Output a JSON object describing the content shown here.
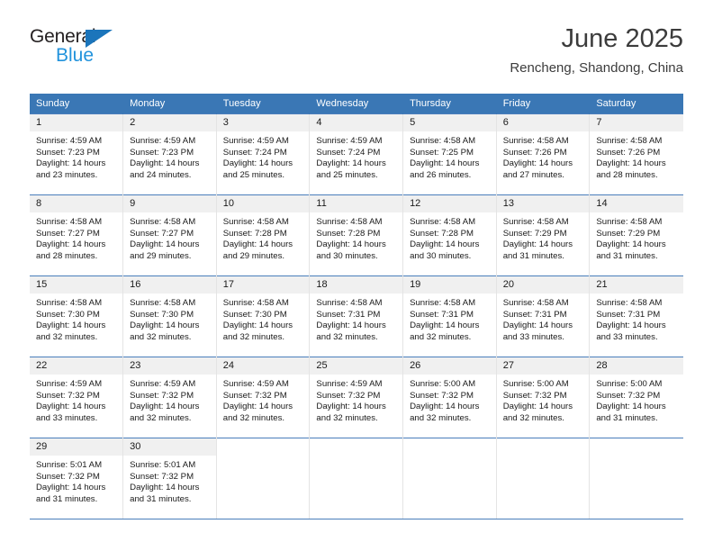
{
  "brand": {
    "name_part1": "General",
    "name_part2": "Blue",
    "triangle_color": "#1b75bb",
    "blue_color": "#2293dc"
  },
  "header": {
    "title": "June 2025",
    "subtitle": "Rencheng, Shandong, China"
  },
  "theme": {
    "header_bg": "#3a77b5",
    "header_text": "#ffffff",
    "row_border": "#4a7ebb",
    "daynum_bg": "#f0f0f0",
    "cell_bg": "#ffffff",
    "text": "#1a1a1a"
  },
  "weekdays": [
    "Sunday",
    "Monday",
    "Tuesday",
    "Wednesday",
    "Thursday",
    "Friday",
    "Saturday"
  ],
  "weeks": [
    [
      {
        "day": "1",
        "sunrise": "Sunrise: 4:59 AM",
        "sunset": "Sunset: 7:23 PM",
        "daylight": "Daylight: 14 hours and 23 minutes."
      },
      {
        "day": "2",
        "sunrise": "Sunrise: 4:59 AM",
        "sunset": "Sunset: 7:23 PM",
        "daylight": "Daylight: 14 hours and 24 minutes."
      },
      {
        "day": "3",
        "sunrise": "Sunrise: 4:59 AM",
        "sunset": "Sunset: 7:24 PM",
        "daylight": "Daylight: 14 hours and 25 minutes."
      },
      {
        "day": "4",
        "sunrise": "Sunrise: 4:59 AM",
        "sunset": "Sunset: 7:24 PM",
        "daylight": "Daylight: 14 hours and 25 minutes."
      },
      {
        "day": "5",
        "sunrise": "Sunrise: 4:58 AM",
        "sunset": "Sunset: 7:25 PM",
        "daylight": "Daylight: 14 hours and 26 minutes."
      },
      {
        "day": "6",
        "sunrise": "Sunrise: 4:58 AM",
        "sunset": "Sunset: 7:26 PM",
        "daylight": "Daylight: 14 hours and 27 minutes."
      },
      {
        "day": "7",
        "sunrise": "Sunrise: 4:58 AM",
        "sunset": "Sunset: 7:26 PM",
        "daylight": "Daylight: 14 hours and 28 minutes."
      }
    ],
    [
      {
        "day": "8",
        "sunrise": "Sunrise: 4:58 AM",
        "sunset": "Sunset: 7:27 PM",
        "daylight": "Daylight: 14 hours and 28 minutes."
      },
      {
        "day": "9",
        "sunrise": "Sunrise: 4:58 AM",
        "sunset": "Sunset: 7:27 PM",
        "daylight": "Daylight: 14 hours and 29 minutes."
      },
      {
        "day": "10",
        "sunrise": "Sunrise: 4:58 AM",
        "sunset": "Sunset: 7:28 PM",
        "daylight": "Daylight: 14 hours and 29 minutes."
      },
      {
        "day": "11",
        "sunrise": "Sunrise: 4:58 AM",
        "sunset": "Sunset: 7:28 PM",
        "daylight": "Daylight: 14 hours and 30 minutes."
      },
      {
        "day": "12",
        "sunrise": "Sunrise: 4:58 AM",
        "sunset": "Sunset: 7:28 PM",
        "daylight": "Daylight: 14 hours and 30 minutes."
      },
      {
        "day": "13",
        "sunrise": "Sunrise: 4:58 AM",
        "sunset": "Sunset: 7:29 PM",
        "daylight": "Daylight: 14 hours and 31 minutes."
      },
      {
        "day": "14",
        "sunrise": "Sunrise: 4:58 AM",
        "sunset": "Sunset: 7:29 PM",
        "daylight": "Daylight: 14 hours and 31 minutes."
      }
    ],
    [
      {
        "day": "15",
        "sunrise": "Sunrise: 4:58 AM",
        "sunset": "Sunset: 7:30 PM",
        "daylight": "Daylight: 14 hours and 32 minutes."
      },
      {
        "day": "16",
        "sunrise": "Sunrise: 4:58 AM",
        "sunset": "Sunset: 7:30 PM",
        "daylight": "Daylight: 14 hours and 32 minutes."
      },
      {
        "day": "17",
        "sunrise": "Sunrise: 4:58 AM",
        "sunset": "Sunset: 7:30 PM",
        "daylight": "Daylight: 14 hours and 32 minutes."
      },
      {
        "day": "18",
        "sunrise": "Sunrise: 4:58 AM",
        "sunset": "Sunset: 7:31 PM",
        "daylight": "Daylight: 14 hours and 32 minutes."
      },
      {
        "day": "19",
        "sunrise": "Sunrise: 4:58 AM",
        "sunset": "Sunset: 7:31 PM",
        "daylight": "Daylight: 14 hours and 32 minutes."
      },
      {
        "day": "20",
        "sunrise": "Sunrise: 4:58 AM",
        "sunset": "Sunset: 7:31 PM",
        "daylight": "Daylight: 14 hours and 33 minutes."
      },
      {
        "day": "21",
        "sunrise": "Sunrise: 4:58 AM",
        "sunset": "Sunset: 7:31 PM",
        "daylight": "Daylight: 14 hours and 33 minutes."
      }
    ],
    [
      {
        "day": "22",
        "sunrise": "Sunrise: 4:59 AM",
        "sunset": "Sunset: 7:32 PM",
        "daylight": "Daylight: 14 hours and 33 minutes."
      },
      {
        "day": "23",
        "sunrise": "Sunrise: 4:59 AM",
        "sunset": "Sunset: 7:32 PM",
        "daylight": "Daylight: 14 hours and 32 minutes."
      },
      {
        "day": "24",
        "sunrise": "Sunrise: 4:59 AM",
        "sunset": "Sunset: 7:32 PM",
        "daylight": "Daylight: 14 hours and 32 minutes."
      },
      {
        "day": "25",
        "sunrise": "Sunrise: 4:59 AM",
        "sunset": "Sunset: 7:32 PM",
        "daylight": "Daylight: 14 hours and 32 minutes."
      },
      {
        "day": "26",
        "sunrise": "Sunrise: 5:00 AM",
        "sunset": "Sunset: 7:32 PM",
        "daylight": "Daylight: 14 hours and 32 minutes."
      },
      {
        "day": "27",
        "sunrise": "Sunrise: 5:00 AM",
        "sunset": "Sunset: 7:32 PM",
        "daylight": "Daylight: 14 hours and 32 minutes."
      },
      {
        "day": "28",
        "sunrise": "Sunrise: 5:00 AM",
        "sunset": "Sunset: 7:32 PM",
        "daylight": "Daylight: 14 hours and 31 minutes."
      }
    ],
    [
      {
        "day": "29",
        "sunrise": "Sunrise: 5:01 AM",
        "sunset": "Sunset: 7:32 PM",
        "daylight": "Daylight: 14 hours and 31 minutes."
      },
      {
        "day": "30",
        "sunrise": "Sunrise: 5:01 AM",
        "sunset": "Sunset: 7:32 PM",
        "daylight": "Daylight: 14 hours and 31 minutes."
      },
      {
        "day": "",
        "sunrise": "",
        "sunset": "",
        "daylight": ""
      },
      {
        "day": "",
        "sunrise": "",
        "sunset": "",
        "daylight": ""
      },
      {
        "day": "",
        "sunrise": "",
        "sunset": "",
        "daylight": ""
      },
      {
        "day": "",
        "sunrise": "",
        "sunset": "",
        "daylight": ""
      },
      {
        "day": "",
        "sunrise": "",
        "sunset": "",
        "daylight": ""
      }
    ]
  ]
}
